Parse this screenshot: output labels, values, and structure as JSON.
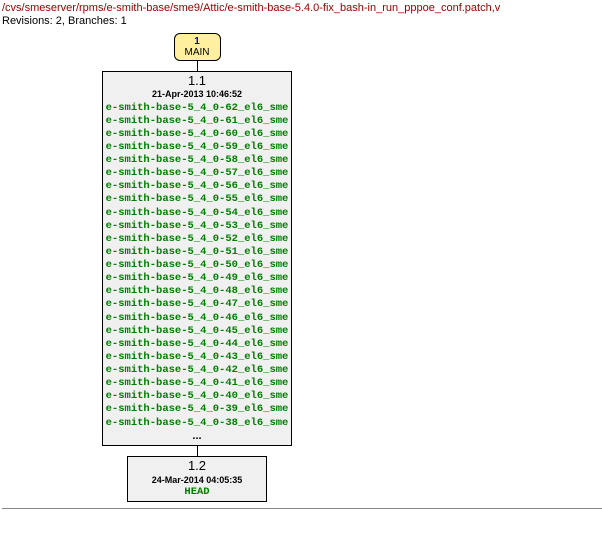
{
  "header": {
    "path": "/cvs/smeserver/rpms/e-smith-base/sme9/Attic/e-smith-base-5.4.0-fix_bash-in_run_pppoe_conf.patch,v",
    "revisions_line": "Revisions: 2, Branches: 1"
  },
  "main_node": {
    "number": "1",
    "label": "MAIN"
  },
  "rev1": {
    "version": "1.1",
    "date": "21-Apr-2013 10:46:52",
    "tags": [
      "e-smith-base-5_4_0-62_el6_sme",
      "e-smith-base-5_4_0-61_el6_sme",
      "e-smith-base-5_4_0-60_el6_sme",
      "e-smith-base-5_4_0-59_el6_sme",
      "e-smith-base-5_4_0-58_el6_sme",
      "e-smith-base-5_4_0-57_el6_sme",
      "e-smith-base-5_4_0-56_el6_sme",
      "e-smith-base-5_4_0-55_el6_sme",
      "e-smith-base-5_4_0-54_el6_sme",
      "e-smith-base-5_4_0-53_el6_sme",
      "e-smith-base-5_4_0-52_el6_sme",
      "e-smith-base-5_4_0-51_el6_sme",
      "e-smith-base-5_4_0-50_el6_sme",
      "e-smith-base-5_4_0-49_el6_sme",
      "e-smith-base-5_4_0-48_el6_sme",
      "e-smith-base-5_4_0-47_el6_sme",
      "e-smith-base-5_4_0-46_el6_sme",
      "e-smith-base-5_4_0-45_el6_sme",
      "e-smith-base-5_4_0-44_el6_sme",
      "e-smith-base-5_4_0-43_el6_sme",
      "e-smith-base-5_4_0-42_el6_sme",
      "e-smith-base-5_4_0-41_el6_sme",
      "e-smith-base-5_4_0-40_el6_sme",
      "e-smith-base-5_4_0-39_el6_sme",
      "e-smith-base-5_4_0-38_el6_sme"
    ],
    "more": "..."
  },
  "rev2": {
    "version": "1.2",
    "date": "24-Mar-2014 04:05:35",
    "tag": "HEAD"
  }
}
